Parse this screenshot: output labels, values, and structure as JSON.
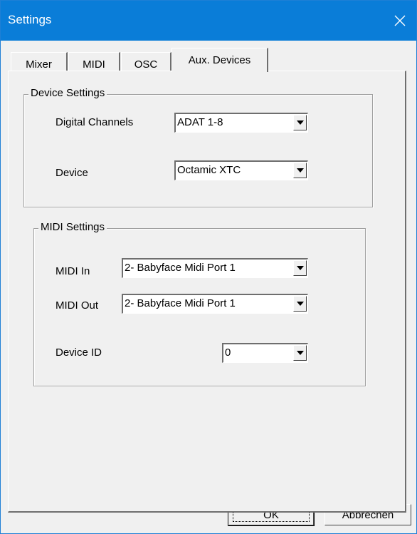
{
  "window": {
    "title": "Settings"
  },
  "tabs": [
    {
      "label": "Mixer"
    },
    {
      "label": "MIDI"
    },
    {
      "label": "OSC"
    },
    {
      "label": "Aux. Devices",
      "active": true
    }
  ],
  "device_settings": {
    "title": "Device Settings",
    "digital_channels": {
      "label": "Digital Channels",
      "value": "ADAT 1-8"
    },
    "device": {
      "label": "Device",
      "value": "Octamic XTC"
    }
  },
  "midi_settings": {
    "title": "MIDI Settings",
    "midi_in": {
      "label": "MIDI In",
      "value": "2- Babyface Midi Port 1"
    },
    "midi_out": {
      "label": "MIDI Out",
      "value": "2- Babyface Midi Port 1"
    },
    "device_id": {
      "label": "Device ID",
      "value": "0"
    }
  },
  "buttons": {
    "ok": "OK",
    "cancel": "Abbrechen"
  },
  "colors": {
    "titlebar": "#0a7dd8",
    "face": "#f0f0f0"
  }
}
